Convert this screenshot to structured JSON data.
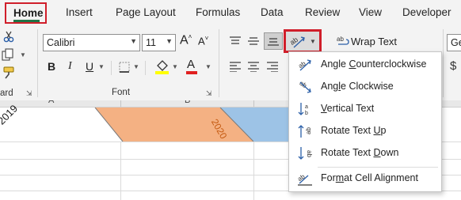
{
  "tabs": {
    "home": "Home",
    "insert": "Insert",
    "page_layout": "Page Layout",
    "formulas": "Formulas",
    "data": "Data",
    "review": "Review",
    "view": "View",
    "developer": "Developer"
  },
  "font_group": {
    "font_name": "Calibri",
    "font_size": "11",
    "label": "Font",
    "bold": "B",
    "italic": "I",
    "underline": "U",
    "grow_font": "A",
    "shrink_font": "A",
    "font_color": "A"
  },
  "clipboard_group": {
    "label_fragment": "ard"
  },
  "alignment_group": {
    "wrap_text": "Wrap Text"
  },
  "number_group": {
    "format_fragment": "Ge",
    "currency_fragment": "$"
  },
  "column_headers": [
    "A",
    "B"
  ],
  "cells": {
    "angled_ccw": "2019",
    "angled_cw": "2020"
  },
  "orientation_menu": {
    "items": [
      {
        "label": "Angle Counterclockwise",
        "icon": "angle-counterclockwise-icon"
      },
      {
        "label": "Angle Clockwise",
        "icon": "angle-clockwise-icon"
      },
      {
        "label": "Vertical Text",
        "icon": "vertical-text-icon"
      },
      {
        "label": "Rotate Text Up",
        "icon": "rotate-text-up-icon"
      },
      {
        "label": "Rotate Text Down",
        "icon": "rotate-text-down-icon"
      },
      {
        "label": "Format Cell Alignment",
        "icon": "format-cell-alignment-icon"
      }
    ]
  },
  "colors": {
    "highlight_box": "#d01e2a",
    "active_tab_underline": "#217346",
    "orange_fill": "#f4b183",
    "blue_fill": "#9dc3e6",
    "font_color_bar": "#e02020",
    "fill_color_bar": "#ffff00"
  }
}
